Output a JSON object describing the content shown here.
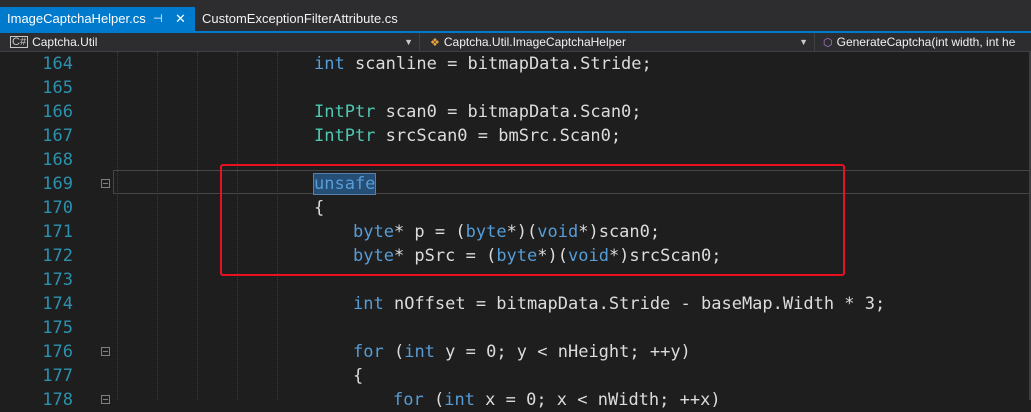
{
  "tabs": [
    {
      "label": "ImageCaptchaHelper.cs",
      "active": true,
      "pin_icon": "pin-icon",
      "close_icon": "close-icon"
    },
    {
      "label": "CustomExceptionFilterAttribute.cs",
      "active": false
    }
  ],
  "nav": {
    "project": {
      "label": "Captcha.Util",
      "icon": "project-icon"
    },
    "class": {
      "label": "Captcha.Util.ImageCaptchaHelper",
      "icon": "class-icon"
    },
    "member": {
      "label": "GenerateCaptcha(int width, int he",
      "icon": "method-icon"
    }
  },
  "colors": {
    "accent": "#007acc",
    "keyword": "#569cd6",
    "type": "#4ec9b0",
    "line_number": "#2b91af",
    "highlight_box": "#e81123",
    "background": "#1e1e1e"
  },
  "lines": [
    {
      "num": "164",
      "indent": 1,
      "tokens": [
        {
          "t": "int",
          "c": "kw"
        },
        {
          "t": " scanline = bitmapData.Stride;",
          "c": "tx"
        }
      ]
    },
    {
      "num": "165",
      "indent": 1,
      "tokens": []
    },
    {
      "num": "166",
      "indent": 1,
      "tokens": [
        {
          "t": "IntPtr",
          "c": "cls"
        },
        {
          "t": " scan0 = bitmapData.Scan0;",
          "c": "tx"
        }
      ]
    },
    {
      "num": "167",
      "indent": 1,
      "tokens": [
        {
          "t": "IntPtr",
          "c": "cls"
        },
        {
          "t": " srcScan0 = bmSrc.Scan0;",
          "c": "tx"
        }
      ]
    },
    {
      "num": "168",
      "indent": 1,
      "tokens": []
    },
    {
      "num": "169",
      "indent": 1,
      "fold": true,
      "tokens": [
        {
          "t": "unsafe",
          "c": "kw sel"
        }
      ]
    },
    {
      "num": "170",
      "indent": 1,
      "tokens": [
        {
          "t": "{",
          "c": "tx"
        }
      ]
    },
    {
      "num": "171",
      "indent": 2,
      "tokens": [
        {
          "t": "byte",
          "c": "kw"
        },
        {
          "t": "* p = (",
          "c": "tx"
        },
        {
          "t": "byte",
          "c": "kw"
        },
        {
          "t": "*)(",
          "c": "tx"
        },
        {
          "t": "void",
          "c": "kw"
        },
        {
          "t": "*)scan0;",
          "c": "tx"
        }
      ]
    },
    {
      "num": "172",
      "indent": 2,
      "tokens": [
        {
          "t": "byte",
          "c": "kw"
        },
        {
          "t": "* pSrc = (",
          "c": "tx"
        },
        {
          "t": "byte",
          "c": "kw"
        },
        {
          "t": "*)(",
          "c": "tx"
        },
        {
          "t": "void",
          "c": "kw"
        },
        {
          "t": "*)srcScan0;",
          "c": "tx"
        }
      ]
    },
    {
      "num": "173",
      "indent": 2,
      "tokens": []
    },
    {
      "num": "174",
      "indent": 2,
      "tokens": [
        {
          "t": "int",
          "c": "kw"
        },
        {
          "t": " nOffset = bitmapData.Stride - baseMap.Width * 3;",
          "c": "tx"
        }
      ]
    },
    {
      "num": "175",
      "indent": 2,
      "tokens": []
    },
    {
      "num": "176",
      "indent": 2,
      "fold": true,
      "tokens": [
        {
          "t": "for",
          "c": "kw"
        },
        {
          "t": " (",
          "c": "tx"
        },
        {
          "t": "int",
          "c": "kw"
        },
        {
          "t": " y = 0; y < nHeight; ++y)",
          "c": "tx"
        }
      ]
    },
    {
      "num": "177",
      "indent": 2,
      "tokens": [
        {
          "t": "{",
          "c": "tx"
        }
      ]
    },
    {
      "num": "178",
      "indent": 3,
      "fold": true,
      "tokens": [
        {
          "t": "for",
          "c": "kw"
        },
        {
          "t": " (",
          "c": "tx"
        },
        {
          "t": "int",
          "c": "kw"
        },
        {
          "t": " x = 0; x < nWidth; ++x)",
          "c": "tx"
        }
      ]
    }
  ]
}
